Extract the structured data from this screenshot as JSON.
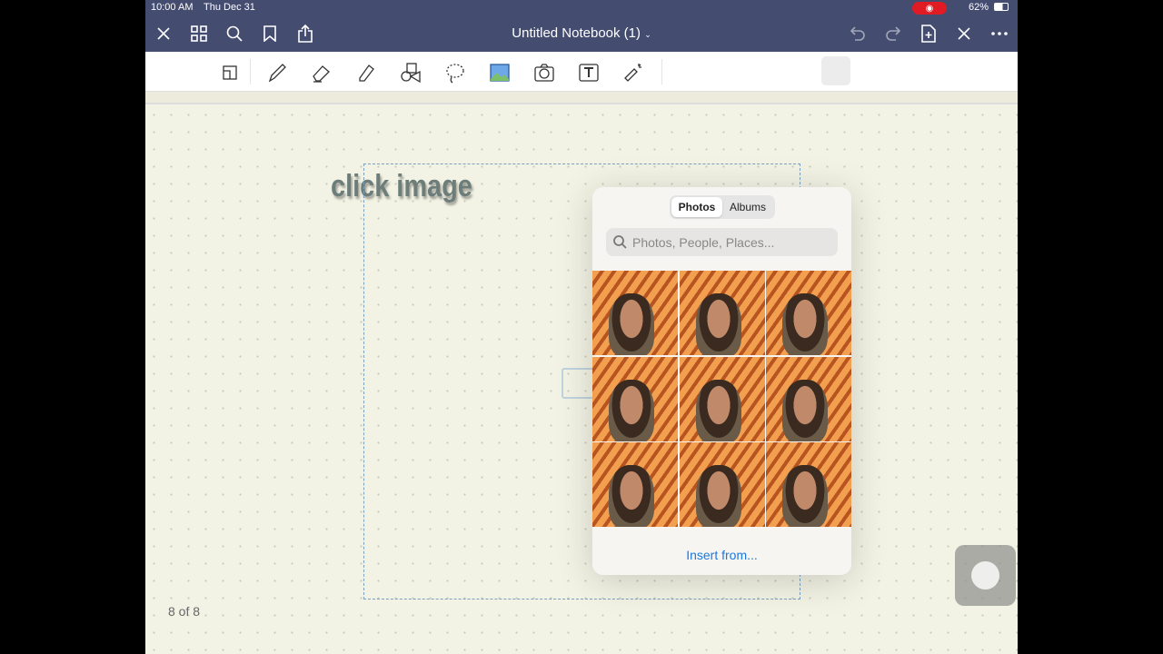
{
  "status": {
    "time": "10:00 AM",
    "date": "Thu Dec 31",
    "battery": "62%"
  },
  "header": {
    "title": "Untitled Notebook (1)"
  },
  "canvas": {
    "text": "click image",
    "page_indicator": "8 of 8"
  },
  "popover": {
    "tabs": [
      {
        "label": "Photos",
        "active": true
      },
      {
        "label": "Albums",
        "active": false
      }
    ],
    "search_placeholder": "Photos, People, Places...",
    "photo_count_visible": 9,
    "insert_label": "Insert from..."
  },
  "colors": {
    "nav": "#444c70",
    "accent": "#1a7ae0",
    "paper": "#f3f3e5"
  }
}
